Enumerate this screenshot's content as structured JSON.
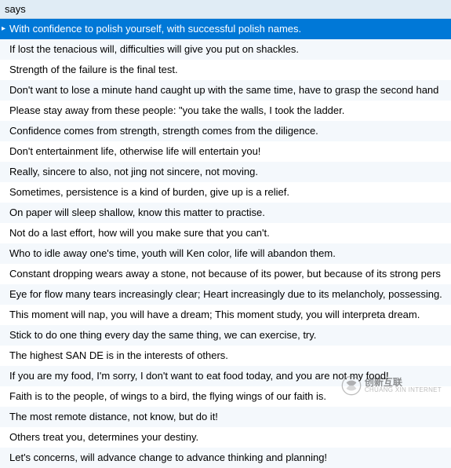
{
  "header": "says",
  "rows": [
    "With confidence to polish yourself, with successful polish names.",
    "If lost the tenacious will, difficulties will give you put on shackles.",
    "Strength of the failure is the final test.",
    "Don't want to lose a minute hand caught up with the same time, have to grasp the second hand",
    "Please stay away from these people: \"you take the walls, I took the ladder.",
    "Confidence comes from strength, strength comes from the diligence.",
    "Don't entertainment life, otherwise life will entertain you!",
    "Really, sincere to also, not jing not sincere, not moving.",
    "Sometimes, persistence is a kind of burden, give up is a relief.",
    "On paper will sleep shallow, know this matter to practise.",
    "Not do a last effort, how will you make sure that you can't.",
    "Who to idle away one's time, youth will Ken color, life will abandon them.",
    "Constant dropping wears away a stone, not because of its power, but because of its strong pers",
    "Eye for flow many tears increasingly clear; Heart increasingly due to its melancholy, possessing.",
    "This moment will nap, you will have a dream; This moment study, you will interpreta dream.",
    "Stick to do one thing every day the same thing, we can exercise, try.",
    "The highest SAN DE is in the interests of others.",
    "If you are my food, I'm sorry, I don't want to eat food today, and you are not my food!",
    "Faith is to the people, of wings to a bird, the flying wings of our faith is.",
    "The most remote distance, not know, but do it!",
    "Others treat you, determines your destiny.",
    "Let's concerns, will advance change to advance thinking and planning!"
  ],
  "selectedIndex": 0,
  "watermark": {
    "main": "创新互联",
    "sub": "CHUANG XIN INTERNET"
  }
}
